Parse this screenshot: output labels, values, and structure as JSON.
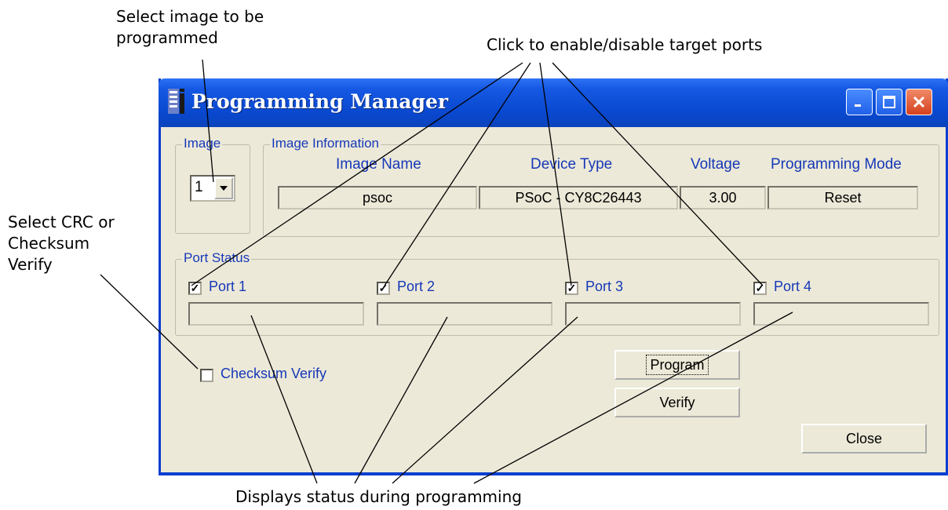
{
  "callouts": {
    "select_image": "Select image to be\nprogrammed",
    "ports": "Click to enable/disable target ports",
    "crc": "Select CRC or\nChecksum\nVerify",
    "status": "Displays status during programming"
  },
  "window": {
    "title": "Programming Manager",
    "title_buttons": [
      "minimize",
      "maximize",
      "close"
    ]
  },
  "image_group": {
    "legend": "Image",
    "selected": "1"
  },
  "info_group": {
    "legend": "Image Information",
    "headers": {
      "image_name": "Image Name",
      "device_type": "Device Type",
      "voltage": "Voltage",
      "programming_mode": "Programming Mode"
    },
    "values": {
      "image_name": "psoc",
      "device_type": "PSoC - CY8C26443",
      "voltage": "3.00",
      "programming_mode": "Reset"
    }
  },
  "port_group": {
    "legend": "Port Status",
    "ports": [
      {
        "label": "Port 1",
        "checked": true,
        "status": ""
      },
      {
        "label": "Port 2",
        "checked": true,
        "status": ""
      },
      {
        "label": "Port 3",
        "checked": true,
        "status": ""
      },
      {
        "label": "Port 4",
        "checked": true,
        "status": ""
      }
    ]
  },
  "checksum_verify": {
    "label": "Checksum Verify",
    "checked": false
  },
  "buttons": {
    "program": "Program",
    "verify": "Verify",
    "close": "Close"
  },
  "colors": {
    "titlebar": "#0a43bb",
    "window_bg": "#ece9d8",
    "label_blue": "#1638b8"
  }
}
